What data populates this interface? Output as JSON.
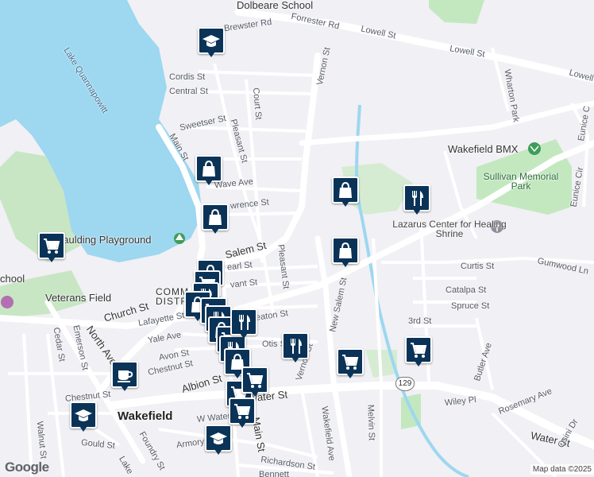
{
  "map": {
    "attribution": "Map data ©2025",
    "logo": "Google",
    "route_shield": "129"
  },
  "labels": {
    "dolbeare_school": "Dolbeare School",
    "brewster_rd": "Brewster Rd",
    "forrester_rd": "Forrester Rd",
    "lowell_st_1": "Lowell St",
    "lowell_st_2": "Lowell St",
    "lowell_st_3": "Lowell St",
    "lake": "Lake Quannapowitt",
    "vernon_st_north": "Vernon St",
    "cordis_st": "Cordis St",
    "central_st": "Central St",
    "court_st": "Court St",
    "wharton_park": "Wharton Park",
    "sweetser_st": "Sweetser St",
    "pleasant_st_north": "Pleasant St",
    "main_st_north": "Main St",
    "wakefield_bmx": "Wakefield BMX",
    "sullivan_park": "Sullivan Memorial Park",
    "wave_ave": "Wave Ave",
    "lawrence_st": "wrence St",
    "lazarus": "Lazarus Center for Healing Shrine",
    "spaulding": "paulding Playground",
    "salem_st": "Salem St",
    "pleasant_st_south": "Pleasant St",
    "curtis_st": "Curtis St",
    "gumwood_ln": "Gumwood Ln",
    "pearl_st": "earl St",
    "chool": "chool",
    "veterans_field": "Veterans Field",
    "community_district": "COMM DISTR",
    "grant_st": "vant St",
    "catalpa_st": "Catalpa St",
    "spruce_st": "Spruce St",
    "church_st": "Church St",
    "lafayette_st": "Lafayette St",
    "eaton_st": "eaton St",
    "new_salem_st": "New Salem St",
    "third_st": "3rd St",
    "butler_ave": "Butler Ave",
    "cedar_st": "Cedar St",
    "emerson_st": "Emerson St",
    "yale_ave": "Yale Ave",
    "otis_st": "Otis S",
    "north_ave": "North Ave",
    "avon_st": "Avon St",
    "chestnut_st_1": "Chestnut St",
    "vernon_st_south": "Vernon St",
    "albion_st": "Albion St",
    "eunice_cir_1": "Eunice C",
    "eunice_cir_2": "Eunice Cir",
    "chestnut_st_2": "Chestnut St",
    "water_st_1": "Water St",
    "wiley_pl": "Wiley Pl",
    "rosemary_ave": "Rosemary Ave",
    "wakefield": "Wakefield",
    "w_water_st": "W Water St",
    "main_st_south": "Main St",
    "wakefield_ave": "Wakefield Ave",
    "melvin_st": "Melvin St",
    "water_st_2": "Water St",
    "osini_dr": "Osini Dr",
    "walnut_st": "Walnut St",
    "gould_st": "Gould St",
    "foundry_st": "Foundry St",
    "armory_st": "Armory St",
    "richardson_st": "Richardson St",
    "lake_ave": "Lake",
    "bennett_st": "Bennett"
  },
  "pins": [
    {
      "name": "school-pin-1",
      "icon": "school-icon"
    },
    {
      "name": "shopping-pin-1",
      "icon": "shopping-bag-icon"
    },
    {
      "name": "shopping-pin-2",
      "icon": "shopping-bag-icon"
    },
    {
      "name": "shopping-pin-3",
      "icon": "shopping-bag-icon"
    },
    {
      "name": "shopping-pin-4",
      "icon": "shopping-bag-icon"
    },
    {
      "name": "restaurant-pin-1",
      "icon": "restaurant-icon"
    },
    {
      "name": "grocery-pin-1",
      "icon": "shopping-cart-icon"
    },
    {
      "name": "restaurant-pin-2",
      "icon": "restaurant-icon"
    },
    {
      "name": "grocery-pin-2",
      "icon": "shopping-cart-icon"
    },
    {
      "name": "grocery-pin-3",
      "icon": "shopping-cart-icon"
    },
    {
      "name": "cafe-pin-1",
      "icon": "cafe-icon"
    },
    {
      "name": "school-pin-2",
      "icon": "school-icon"
    },
    {
      "name": "school-pin-3",
      "icon": "school-icon"
    },
    {
      "name": "grocery-pin-4",
      "icon": "shopping-cart-icon"
    },
    {
      "name": "grocery-pin-5",
      "icon": "shopping-cart-icon"
    },
    {
      "name": "restaurant-pin-3",
      "icon": "restaurant-icon"
    },
    {
      "name": "grocery-pin-6",
      "icon": "shopping-cart-icon"
    }
  ],
  "colors": {
    "pin": "#0a3357",
    "water": "#9dd7f0",
    "park": "#c3e8c0",
    "road": "#ffffff",
    "land": "#f1f0f4"
  }
}
